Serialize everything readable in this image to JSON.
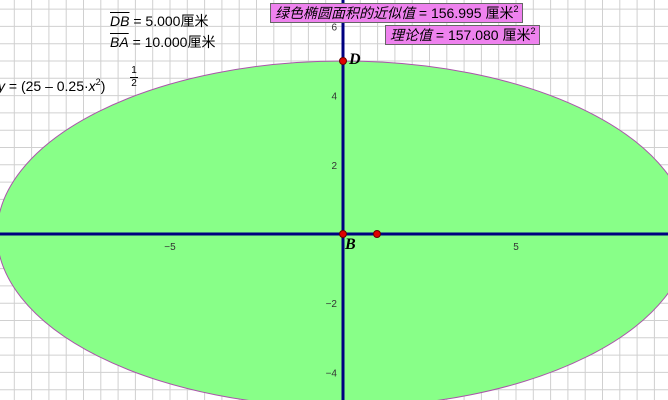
{
  "measurements": {
    "db_label": "DB",
    "db_value": " = 5.000厘米",
    "ba_label": "BA",
    "ba_value": " = 10.000厘米"
  },
  "equation": {
    "lhs": "y",
    "body": " = (25 – 0.25·",
    "var": "x",
    "exp": "2",
    "close": ")",
    "frac_num": "1",
    "frac_den": "2"
  },
  "approx_area": {
    "label": "绿色椭圆面积的近似值",
    "value": " = 156.995 厘米",
    "exp": "2"
  },
  "theory_area": {
    "label": "理论值",
    "value": " = 157.080 厘米",
    "exp": "2"
  },
  "points": {
    "D": "D",
    "B": "B"
  },
  "axes": {
    "x_ticks": [
      "−5",
      "5"
    ],
    "y_ticks": [
      "6",
      "4",
      "2",
      "−2",
      "−4"
    ]
  },
  "colors": {
    "ellipse_fill": "#88ff88",
    "ellipse_stroke": "#aa55aa",
    "axis": "#000080",
    "grid": "#d0d0d0",
    "point": "#e00000",
    "label_box": "#ee82ee"
  }
}
